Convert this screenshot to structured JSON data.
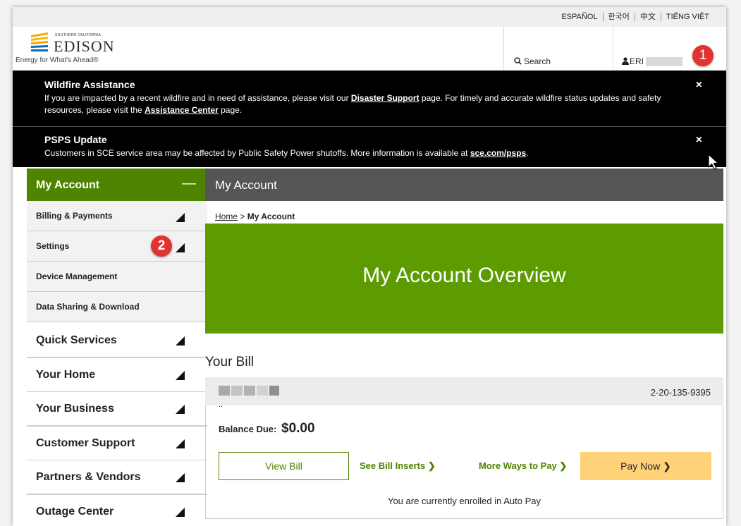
{
  "languages": [
    "ESPAÑOL",
    "한국어",
    "中文",
    "TIẾNG VIỆT"
  ],
  "logo": {
    "small_text": "SOUTHERN CALIFORNIA",
    "name": "EDISON",
    "tagline": "Energy for What's Ahead®"
  },
  "header": {
    "search_label": "Search",
    "user_label": "ERI"
  },
  "annotations": {
    "badge1": "1",
    "badge2": "2"
  },
  "alerts": [
    {
      "title": "Wildfire Assistance",
      "text1": "If you are impacted by a recent wildfire and in need of assistance, please visit our ",
      "link1": "Disaster Support",
      "text2": " page. For timely and accurate wildfire status updates and safety resources, please visit the ",
      "link2": "Assistance Center",
      "text3": " page.",
      "close": "×"
    },
    {
      "title": "PSPS Update",
      "text1": "Customers in SCE service area may be affected by Public Safety Power shutoffs. More information is available at ",
      "link1": "sce.com/psps",
      "text2": ".",
      "close": "×"
    }
  ],
  "sidebar": {
    "header": "My Account",
    "collapse_symbol": "—",
    "sub_items": [
      "Billing & Payments",
      "Settings",
      "Device Management",
      "Data Sharing & Download"
    ],
    "main_items": [
      "Quick Services",
      "Your Home",
      "Your Business",
      "Customer Support",
      "Partners & Vendors",
      "Outage Center"
    ]
  },
  "content": {
    "header": "My Account",
    "breadcrumb_home": "Home",
    "breadcrumb_sep": " > ",
    "breadcrumb_current": "My Account",
    "hero_title": "My Account Overview",
    "your_bill": "Your Bill",
    "account_suffix": "..",
    "account_number": "2-20-135-9395",
    "balance_label": "Balance Due:",
    "balance_amount": "$0.00",
    "view_bill": "View Bill",
    "see_inserts": "See Bill Inserts ❯",
    "more_ways": "More Ways to Pay ❯",
    "pay_now": "Pay Now ❯",
    "autopay_text": "You are currently enrolled in Auto Pay"
  },
  "colors": {
    "brand_green": "#4e8400",
    "hero_green": "#5c9c00",
    "pay_button": "#ffd27a",
    "alert_bg": "#000000",
    "badge_red": "#e0322f"
  }
}
